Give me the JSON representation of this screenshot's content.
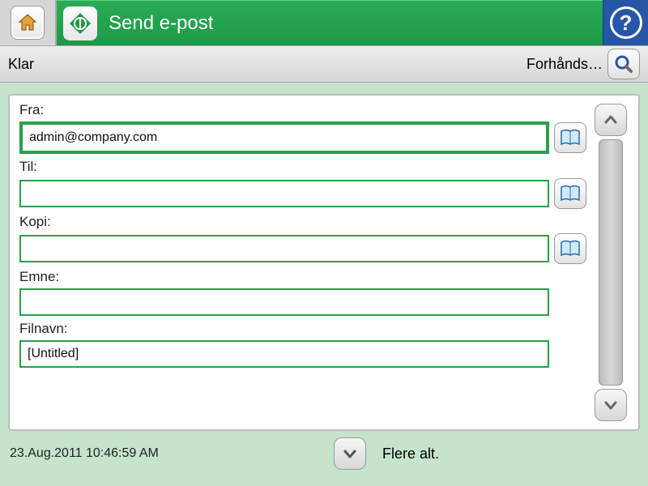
{
  "header": {
    "title": "Send e-post"
  },
  "statusbar": {
    "status": "Klar",
    "preview_label": "Forhånds…"
  },
  "form": {
    "from": {
      "label": "Fra:",
      "value": "admin@company.com",
      "has_addressbook": true,
      "emphasis": true
    },
    "to": {
      "label": "Til:",
      "value": "",
      "has_addressbook": true
    },
    "cc": {
      "label": "Kopi:",
      "value": "",
      "has_addressbook": true
    },
    "subject": {
      "label": "Emne:",
      "value": "",
      "has_addressbook": false
    },
    "filename": {
      "label": "Filnavn:",
      "value": "[Untitled]",
      "has_addressbook": false
    }
  },
  "footer": {
    "timestamp": "23.Aug.2011 10:46:59 AM",
    "more_label": "Flere alt."
  }
}
